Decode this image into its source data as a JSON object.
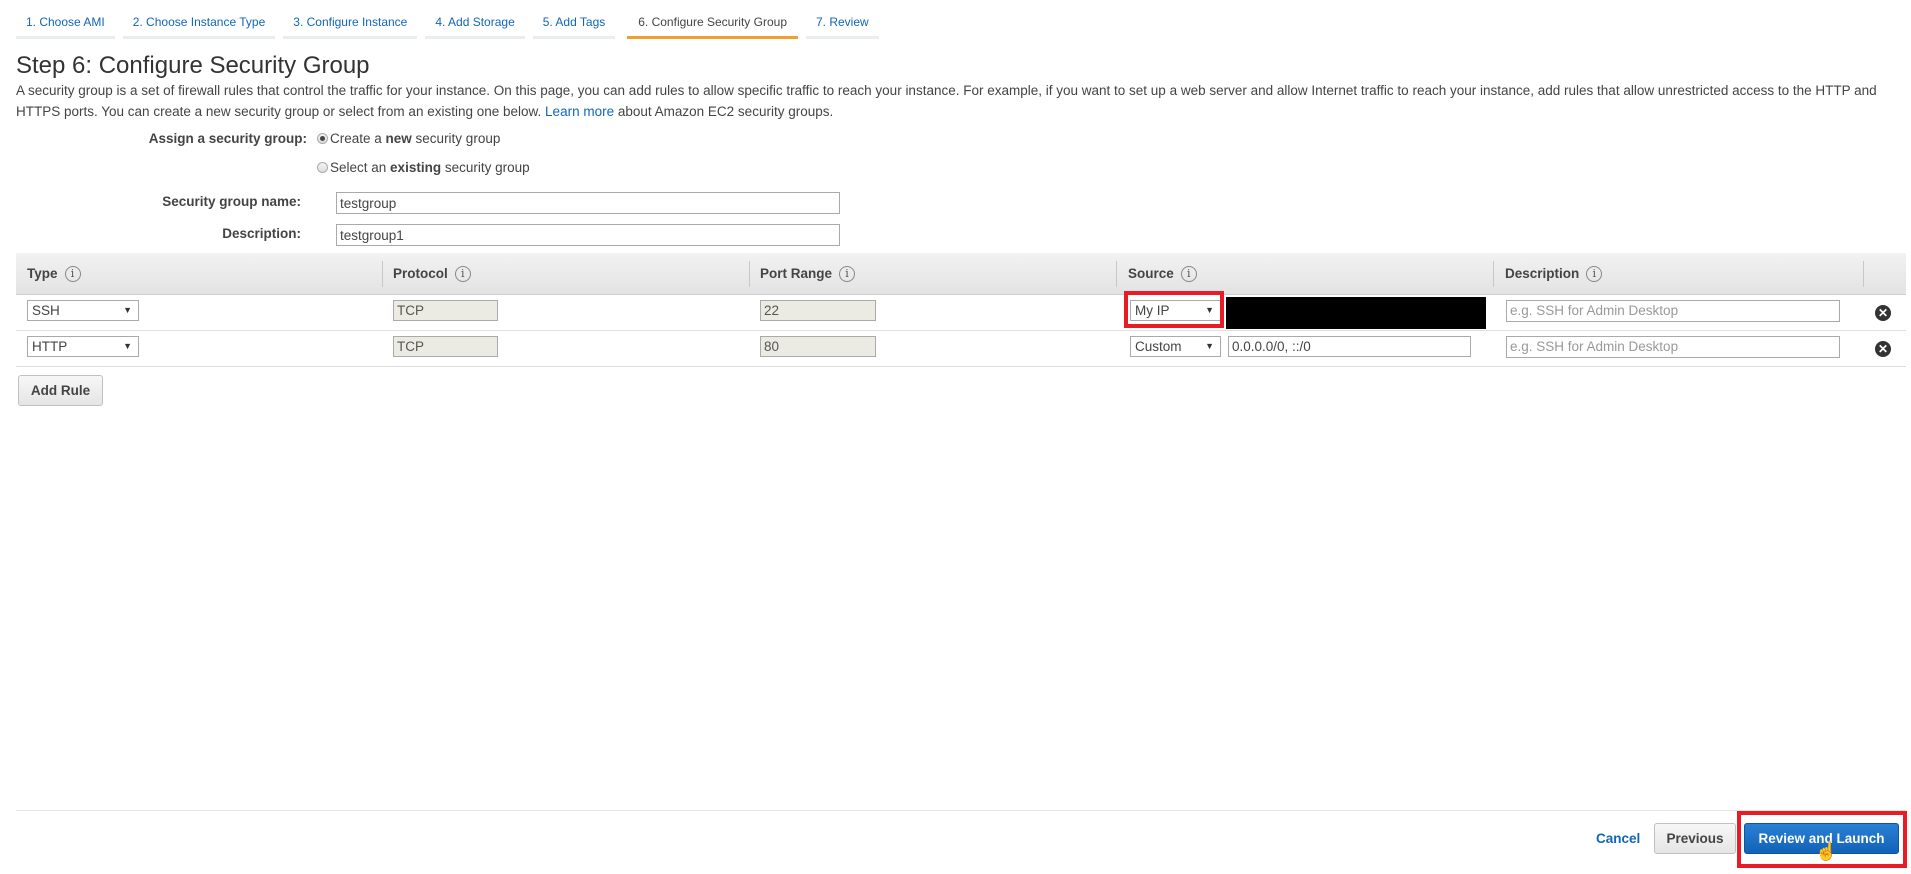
{
  "wizard": {
    "tabs": [
      {
        "label": "1. Choose AMI",
        "active": false
      },
      {
        "label": "2. Choose Instance Type",
        "active": false
      },
      {
        "label": "3. Configure Instance",
        "active": false
      },
      {
        "label": "4. Add Storage",
        "active": false
      },
      {
        "label": "5. Add Tags",
        "active": false
      },
      {
        "label": "6. Configure Security Group",
        "active": true
      },
      {
        "label": "7. Review",
        "active": false
      }
    ]
  },
  "page": {
    "title": "Step 6: Configure Security Group",
    "intro_text": "A security group is a set of firewall rules that control the traffic for your instance. On this page, you can add rules to allow specific traffic to reach your instance. For example, if you want to set up a web server and allow Internet traffic to reach your instance, add rules that allow unrestricted access to the HTTP and HTTPS ports. You can create a new security group or select from an existing one below.",
    "learn_more_link": "Learn more",
    "intro_suffix": "about Amazon EC2 security groups."
  },
  "assign": {
    "label": "Assign a security group:",
    "options": [
      {
        "prefix": "Create a ",
        "bold": "new",
        "suffix": " security group",
        "checked": true
      },
      {
        "prefix": "Select an ",
        "bold": "existing",
        "suffix": " security group",
        "checked": false
      }
    ]
  },
  "form": {
    "name_label": "Security group name:",
    "name_value": "testgroup",
    "description_label": "Description:",
    "description_value": "testgroup1"
  },
  "rules_table": {
    "columns": [
      "Type",
      "Protocol",
      "Port Range",
      "Source",
      "Description"
    ],
    "rows": [
      {
        "type": "SSH",
        "protocol": "TCP",
        "port_range": "22",
        "source_type": "My IP",
        "source_cidr": "",
        "source_redacted": true,
        "description_placeholder": "e.g. SSH for Admin Desktop"
      },
      {
        "type": "HTTP",
        "protocol": "TCP",
        "port_range": "80",
        "source_type": "Custom",
        "source_cidr": "0.0.0.0/0, ::/0",
        "source_redacted": false,
        "description_placeholder": "e.g. SSH for Admin Desktop"
      }
    ],
    "add_rule_label": "Add Rule"
  },
  "footer": {
    "cancel_label": "Cancel",
    "previous_label": "Previous",
    "review_launch_label": "Review and Launch"
  },
  "colors": {
    "accent_tab": "#f0a12d",
    "link": "#1166bb",
    "primary_button": "#1a6fc4",
    "highlight": "#e81c25"
  }
}
